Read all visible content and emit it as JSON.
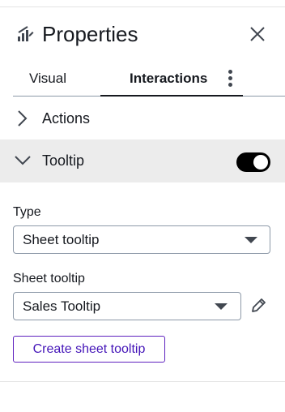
{
  "panel": {
    "title": "Properties",
    "icons": {
      "header": "bar-chart-edit-icon",
      "close": "close-icon",
      "more": "more-vertical-icon"
    }
  },
  "tabs": [
    {
      "label": "Visual",
      "active": false
    },
    {
      "label": "Interactions",
      "active": true
    }
  ],
  "sections": {
    "actions": {
      "label": "Actions",
      "expanded": false
    },
    "tooltip": {
      "label": "Tooltip",
      "expanded": true,
      "enabled": true
    }
  },
  "tooltip_settings": {
    "type_label": "Type",
    "type_value": "Sheet tooltip",
    "sheet_tooltip_label": "Sheet tooltip",
    "sheet_tooltip_value": "Sales Tooltip",
    "create_button": "Create sheet tooltip"
  },
  "colors": {
    "accent": "#5f22bf",
    "accent_text": "#4415b8",
    "expanded_section_bg": "#ececec",
    "toggle_on": "#000000"
  }
}
